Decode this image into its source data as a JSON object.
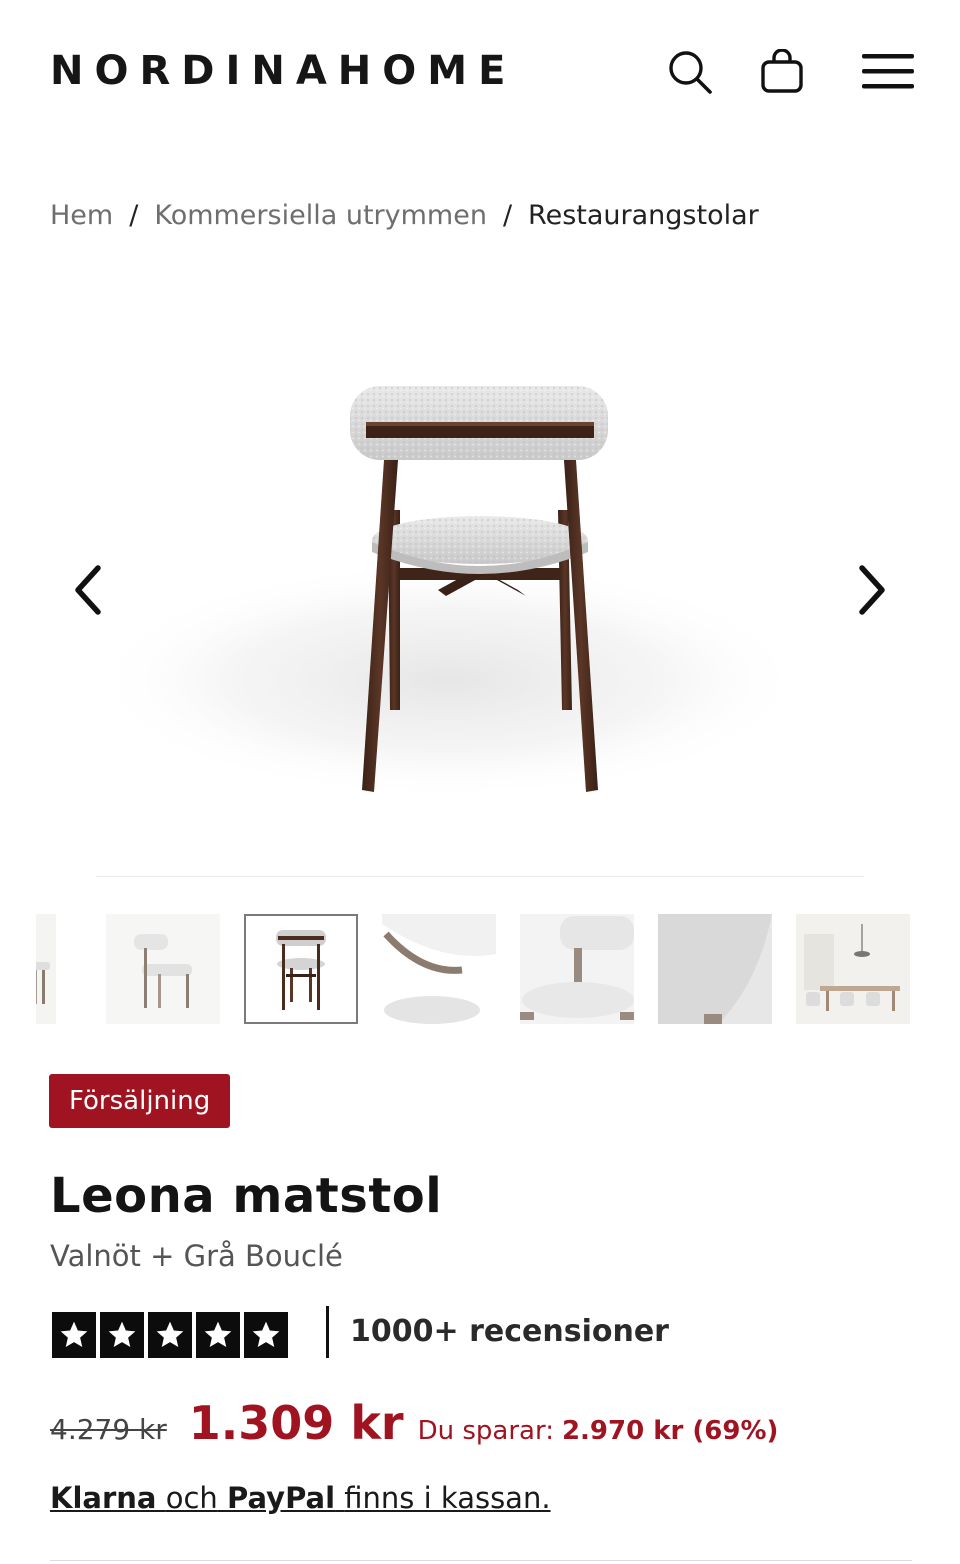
{
  "header": {
    "logo": "NORDINAHOME",
    "icons": {
      "search": "search-icon",
      "cart": "shopping-bag-icon",
      "menu": "hamburger-menu-icon"
    }
  },
  "breadcrumb": {
    "items": [
      "Hem",
      "Kommersiella utrymmen",
      "Restaurangstolar"
    ],
    "separator": "/"
  },
  "gallery": {
    "main_image": "walnut dining chair with grey bouclé seat, back view",
    "prev_icon": "chevron-left-icon",
    "next_icon": "chevron-right-icon",
    "active_thumbnail_index": 2,
    "thumbnail_count": 7
  },
  "product": {
    "badge": "Försäljning",
    "title": "Leona matstol",
    "variant": "Valnöt + Grå Bouclé",
    "rating_stars": 5,
    "reviews_label": "1000+ recensioner",
    "old_price": "4.279 kr",
    "new_price": "1.309 kr",
    "save_label": "Du sparar:",
    "save_value": "2.970 kr (69%)",
    "payment": {
      "klarna": "Klarna",
      "och": "och",
      "paypal": "PayPal",
      "suffix": "finns i kassan."
    }
  },
  "colors": {
    "accent": "#a01421",
    "text": "#1a1a1a",
    "muted": "#6e6e6e",
    "wood": "#4a2b1e",
    "boucle": "#d9d9d9"
  }
}
